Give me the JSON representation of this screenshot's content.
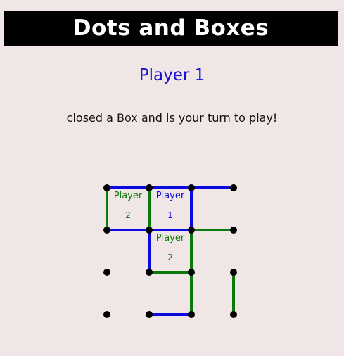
{
  "header": {
    "title": "Dots and Boxes"
  },
  "status": {
    "current_player": "Player 1",
    "message": "closed a Box and is your turn to play!"
  },
  "colors": {
    "background": "#efe6e5",
    "title_bar": "#000000",
    "player1": "#0b0be0",
    "player2": "#0a7a0a",
    "dot": "#000000"
  },
  "board": {
    "rows": 4,
    "cols": 4,
    "horizontal_lines": [
      {
        "row": 0,
        "col": 0,
        "owner": 1
      },
      {
        "row": 0,
        "col": 1,
        "owner": 1
      },
      {
        "row": 0,
        "col": 2,
        "owner": 1
      },
      {
        "row": 1,
        "col": 0,
        "owner": 1
      },
      {
        "row": 1,
        "col": 1,
        "owner": 1
      },
      {
        "row": 1,
        "col": 2,
        "owner": 2
      },
      {
        "row": 2,
        "col": 1,
        "owner": 2
      },
      {
        "row": 3,
        "col": 1,
        "owner": 1
      }
    ],
    "vertical_lines": [
      {
        "row": 0,
        "col": 0,
        "owner": 2
      },
      {
        "row": 0,
        "col": 1,
        "owner": 2
      },
      {
        "row": 0,
        "col": 2,
        "owner": 1
      },
      {
        "row": 1,
        "col": 1,
        "owner": 1
      },
      {
        "row": 1,
        "col": 2,
        "owner": 2
      },
      {
        "row": 2,
        "col": 2,
        "owner": 2
      },
      {
        "row": 2,
        "col": 3,
        "owner": 2
      }
    ],
    "boxes": [
      {
        "row": 0,
        "col": 0,
        "label": "Player",
        "number": "2",
        "owner": 2
      },
      {
        "row": 0,
        "col": 1,
        "label": "Player",
        "number": "1",
        "owner": 1
      },
      {
        "row": 1,
        "col": 1,
        "label": "Player",
        "number": "2",
        "owner": 2
      }
    ]
  }
}
